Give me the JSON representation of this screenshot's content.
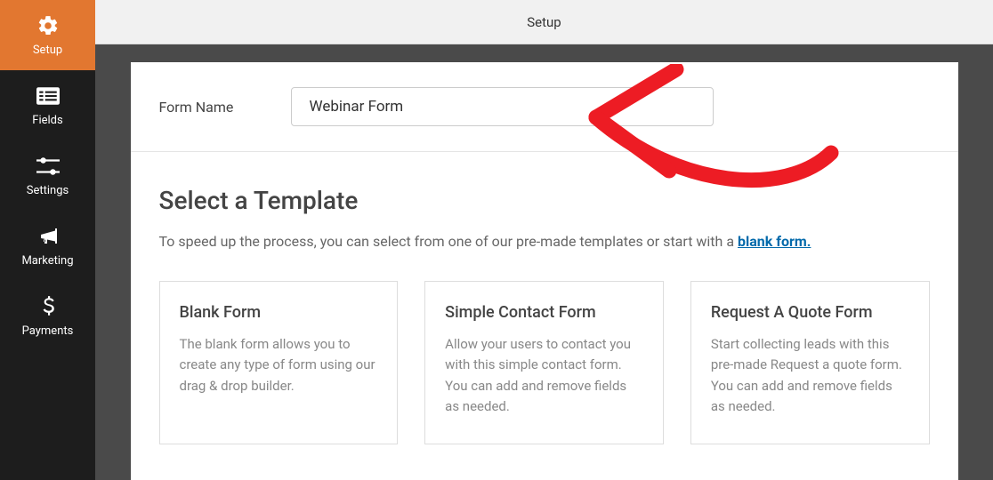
{
  "sidebar": {
    "items": [
      {
        "label": "Setup",
        "active": true
      },
      {
        "label": "Fields",
        "active": false
      },
      {
        "label": "Settings",
        "active": false
      },
      {
        "label": "Marketing",
        "active": false
      },
      {
        "label": "Payments",
        "active": false
      }
    ]
  },
  "topbar": {
    "title": "Setup"
  },
  "formName": {
    "label": "Form Name",
    "value": "Webinar Form"
  },
  "template": {
    "title": "Select a Template",
    "desc_prefix": "To speed up the process, you can select from one of our pre-made templates or start with a ",
    "blank_link": "blank form.",
    "cards": [
      {
        "title": "Blank Form",
        "desc": "The blank form allows you to create any type of form using our drag & drop builder."
      },
      {
        "title": "Simple Contact Form",
        "desc": "Allow your users to contact you with this simple contact form. You can add and remove fields as needed."
      },
      {
        "title": "Request A Quote Form",
        "desc": "Start collecting leads with this pre-made Request a quote form. You can add and remove fields as needed."
      }
    ]
  }
}
